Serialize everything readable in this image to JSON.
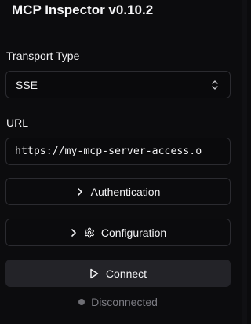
{
  "header": {
    "title": "MCP Inspector v0.10.2"
  },
  "transport": {
    "label": "Transport Type",
    "selected": "SSE"
  },
  "url": {
    "label": "URL",
    "value": "https://my-mcp-server-access.o"
  },
  "buttons": {
    "authentication": "Authentication",
    "configuration": "Configuration",
    "connect": "Connect"
  },
  "status": {
    "text": "Disconnected"
  },
  "colors": {
    "background": "#0c0c0e",
    "border": "#2b2b30",
    "connect_bg": "#232328",
    "status_dot": "#6e6e74"
  },
  "icons": {
    "select": "chevrons-up-down-icon",
    "authentication": "chevron-right-icon",
    "configuration": "gear-icon",
    "connect": "play-icon"
  }
}
